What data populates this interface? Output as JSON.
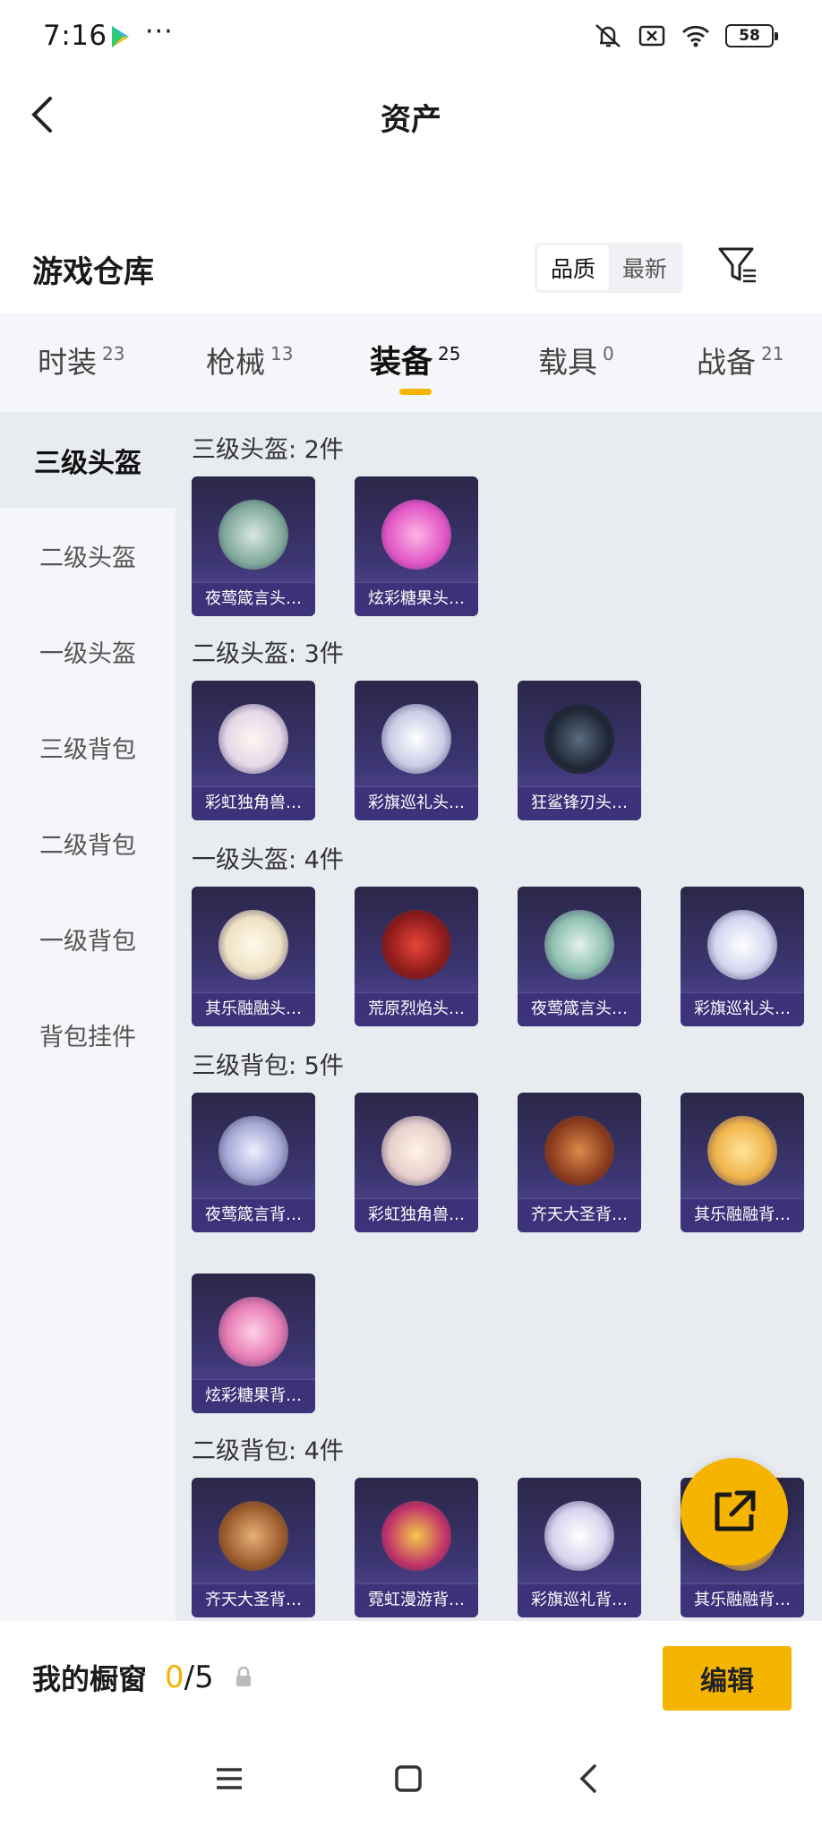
{
  "status_bar": {
    "time": "7:16",
    "more": "···",
    "battery": "58",
    "icons": [
      "play-store-icon",
      "mute-icon",
      "no-sim-icon",
      "wifi-icon",
      "battery-icon"
    ]
  },
  "header": {
    "title": "资产"
  },
  "warehouse": {
    "title": "游戏仓库",
    "sort_options": [
      "品质",
      "最新"
    ],
    "active_sort": "品质"
  },
  "tabs": [
    {
      "label": "时装",
      "count": "23"
    },
    {
      "label": "枪械",
      "count": "13"
    },
    {
      "label": "装备",
      "count": "25"
    },
    {
      "label": "载具",
      "count": "0"
    },
    {
      "label": "战备",
      "count": "21"
    }
  ],
  "active_tab": "装备",
  "side_nav": [
    "三级头盔",
    "二级头盔",
    "一级头盔",
    "三级背包",
    "二级背包",
    "一级背包",
    "背包挂件"
  ],
  "active_side": "三级头盔",
  "groups": [
    {
      "title": "三级头盔: 2件",
      "items": [
        "夜莺箴言头…",
        "炫彩糖果头…"
      ]
    },
    {
      "title": "二级头盔: 3件",
      "items": [
        "彩虹独角兽…",
        "彩旗巡礼头…",
        "狂鲨锋刃头…"
      ]
    },
    {
      "title": "一级头盔: 4件",
      "items": [
        "其乐融融头…",
        "荒原烈焰头…",
        "夜莺箴言头…",
        "彩旗巡礼头…"
      ]
    },
    {
      "title": "三级背包: 5件",
      "items": [
        "夜莺箴言背…",
        "彩虹独角兽…",
        "齐天大圣背…",
        "其乐融融背…",
        "炫彩糖果背…"
      ]
    },
    {
      "title": "二级背包: 4件",
      "items": [
        "齐天大圣背…",
        "霓虹漫游背…",
        "彩旗巡礼背…",
        "其乐融融背…"
      ]
    }
  ],
  "showcase": {
    "label": "我的橱窗",
    "current": "0",
    "total": "/5",
    "edit_label": "编辑"
  }
}
